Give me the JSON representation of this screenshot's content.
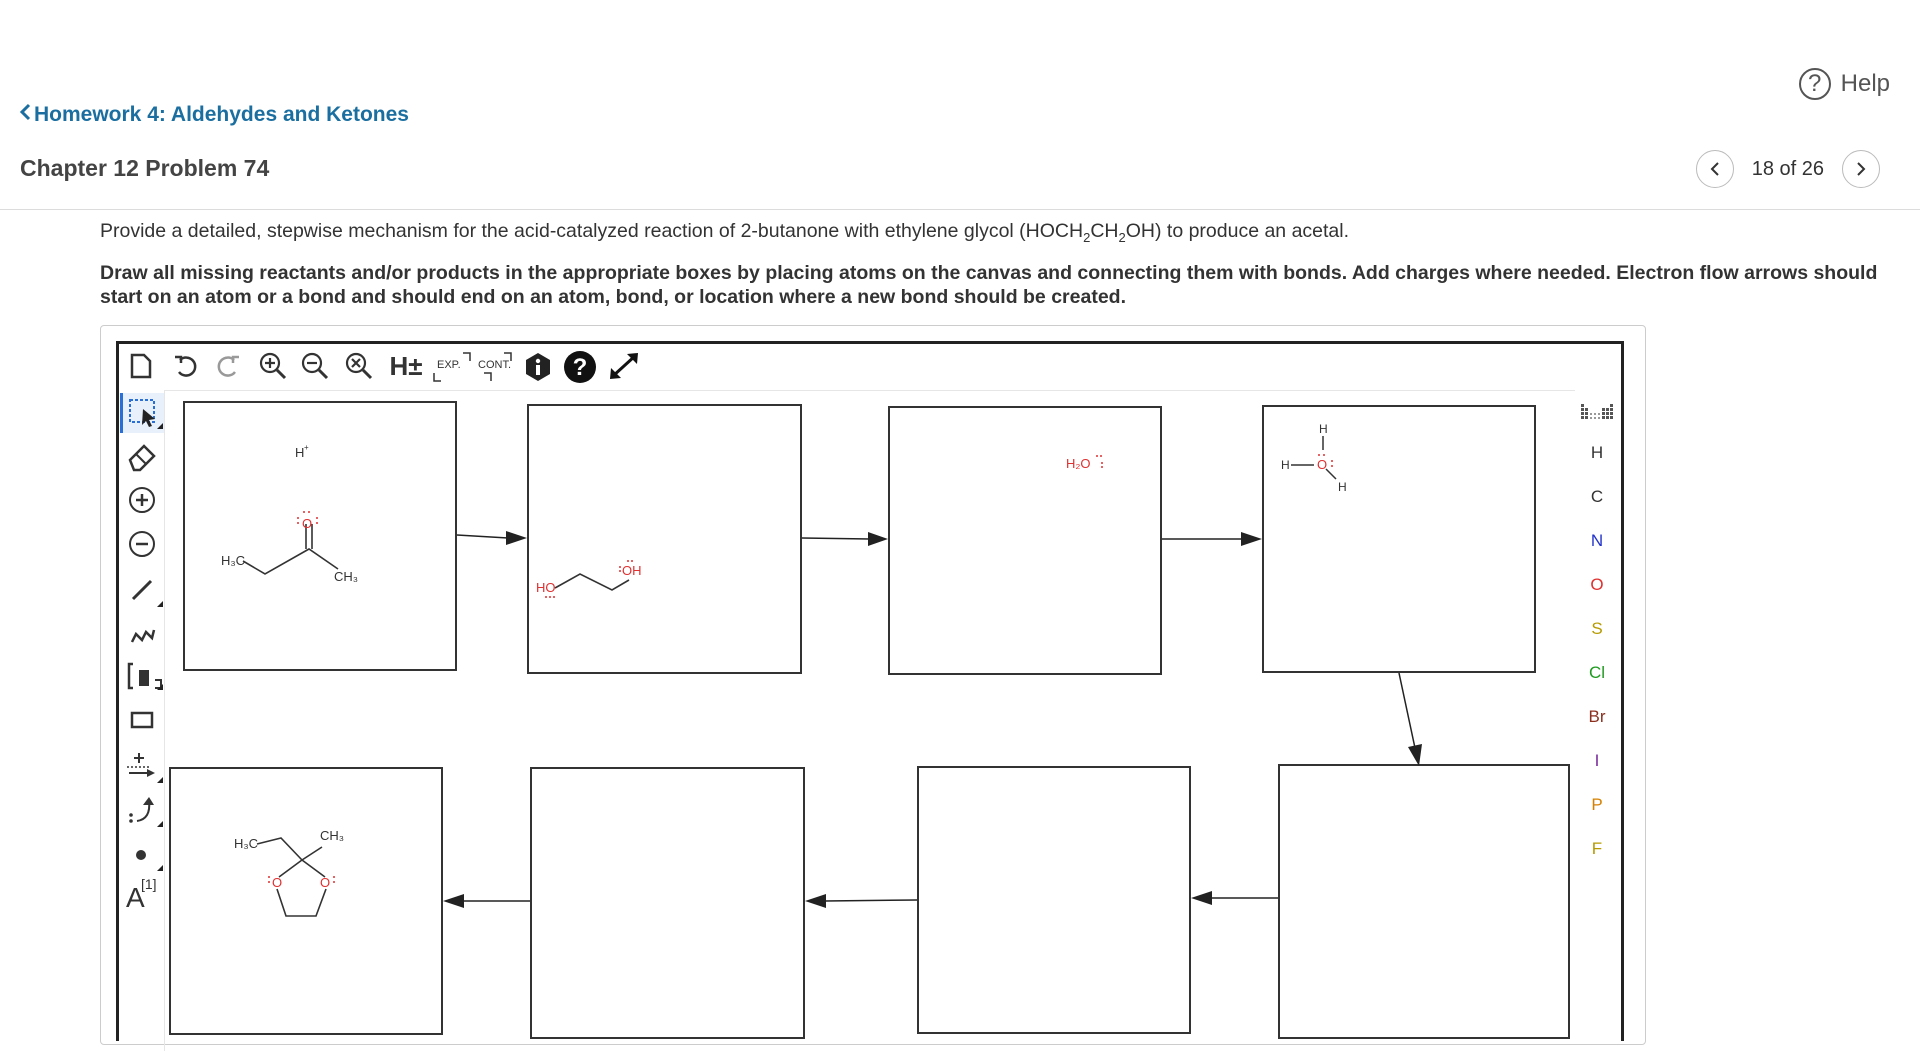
{
  "nav": {
    "help_label": "Help",
    "back_label": "Homework 4: Aldehydes and Ketones",
    "chapter_title": "Chapter 12 Problem 74",
    "pager_text": "18 of 26"
  },
  "question": {
    "intro_pre": "Provide a detailed, stepwise mechanism for the acid-catalyzed reaction of 2-butanone with ethylene glycol (HOCH",
    "intro_sub1": "2",
    "intro_mid": "CH",
    "intro_sub2": "2",
    "intro_post": "OH) to produce an acetal.",
    "instructions": "Draw all missing reactants and/or products in the appropriate boxes by placing atoms on the canvas and connecting them with bonds. Add charges where needed. Electron flow arrows should start on an atom or a bond and should end on an atom, bond, or location where a new bond should be created."
  },
  "toolbar": {
    "h_toggle": "H±",
    "exp_label": "EXP.",
    "cont_label": "CONT.",
    "text_tool_label": "A",
    "text_tool_sup": "[1]"
  },
  "atoms": [
    "H",
    "C",
    "N",
    "O",
    "S",
    "Cl",
    "Br",
    "I",
    "P",
    "F"
  ],
  "atom_colors": {
    "H": "#333333",
    "C": "#333333",
    "N": "#2233cc",
    "O": "#e03030",
    "S": "#b59a00",
    "Cl": "#1f9a1f",
    "Br": "#8b2f1f",
    "I": "#7a2a9a",
    "P": "#d68000",
    "F": "#b59a00"
  },
  "molecules": {
    "box1": {
      "hplus": "H",
      "plus": "+",
      "methyl_left": "H₃C",
      "methyl_right": "CH₃",
      "oxygen": "O"
    },
    "box2": {
      "ho": "HO",
      "oh": "OH"
    },
    "box3": {
      "water": "H₂O"
    },
    "box4": {
      "h_top": "H",
      "h_left": "H",
      "o": "O",
      "h_bottom": "H"
    },
    "box8": {
      "methyl_left": "H₃C",
      "methyl_right": "CH₃",
      "o_left": "O",
      "o_right": "O"
    }
  }
}
